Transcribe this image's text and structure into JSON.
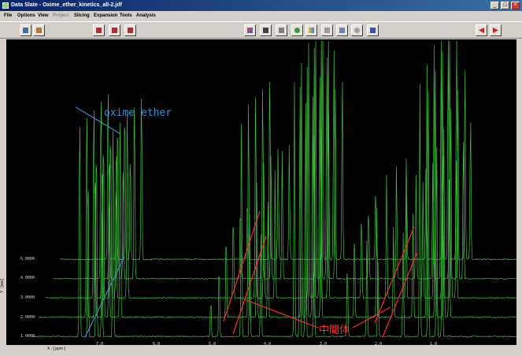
{
  "window": {
    "title": "Data Slate - Oxime_ether_kinetics_all-2.jdf",
    "controls": [
      "_",
      "□",
      "×"
    ]
  },
  "menu": [
    "File",
    "Options",
    "View",
    "Project",
    "Slicing",
    "Expansion",
    "Tools",
    "Analysis"
  ],
  "menu_disabled": [
    "Project"
  ],
  "toolbar_icons": [
    "save-icon",
    "print-icon",
    "stack-plot-icon",
    "overlay-icon",
    "slice-icon",
    "color-icon",
    "cube-icon",
    "layers-icon",
    "refresh-icon",
    "grid-icon",
    "3d-box-icon",
    "settings-icon",
    "zoom-icon",
    "music-note-icon",
    "arrow-left-icon",
    "arrow-right-icon"
  ],
  "colors": {
    "spectrum": "#3fbf3f",
    "blue_annotation": "#2f93d6",
    "red_annotation": "#ff2a2a",
    "background": "#000000"
  },
  "plot": {
    "y_axis_label": "Y : [sec]",
    "x_axis_label": "X : [ ppm ]",
    "y_ticks": [
      "5.0000",
      "4.0000",
      "3.0000",
      "2.0000",
      "1.0000"
    ],
    "x_ticks": [
      "7.0",
      "6.0",
      "5.0",
      "4.0",
      "3.0",
      "2.0",
      "1.0"
    ]
  },
  "annotations": {
    "oxime_ether": "oxime ether",
    "intermediate": "中間体"
  },
  "chart_data": {
    "type": "line",
    "title": "",
    "xlabel": "X : [ ppm ]",
    "ylabel": "Y : [sec]",
    "xlim": [
      8.2,
      -0.6
    ],
    "x_ticks": [
      7.0,
      6.0,
      5.0,
      4.0,
      3.0,
      2.0,
      1.0
    ],
    "y_ticks": [
      1.0,
      2.0,
      3.0,
      4.0,
      5.0
    ],
    "grid": false,
    "series": [
      {
        "y": 1.0,
        "peaks": [
          [
            7.35,
            0.95
          ],
          [
            7.2,
            0.7
          ],
          [
            7.05,
            0.85
          ],
          [
            6.95,
            0.6
          ],
          [
            6.75,
            0.9
          ],
          [
            5.0,
            0.15
          ],
          [
            4.85,
            0.3
          ],
          [
            4.45,
            0.9
          ],
          [
            4.3,
            0.5
          ],
          [
            4.1,
            0.4
          ],
          [
            3.5,
            1.0
          ],
          [
            3.4,
            1.0
          ],
          [
            3.3,
            0.95
          ],
          [
            3.15,
            0.85
          ],
          [
            2.55,
            0.3
          ],
          [
            2.2,
            0.4
          ],
          [
            2.0,
            0.3
          ],
          [
            1.55,
            0.4
          ],
          [
            1.25,
            1.0
          ],
          [
            1.1,
            1.0
          ],
          [
            0.95,
            0.8
          ],
          [
            0.85,
            0.6
          ]
        ]
      },
      {
        "y": 2.0,
        "peaks": [
          [
            7.35,
            0.9
          ],
          [
            7.2,
            0.65
          ],
          [
            7.05,
            0.8
          ],
          [
            6.95,
            0.55
          ],
          [
            6.75,
            0.85
          ],
          [
            4.85,
            0.35
          ],
          [
            4.45,
            0.9
          ],
          [
            4.3,
            0.55
          ],
          [
            4.1,
            0.45
          ],
          [
            3.5,
            1.0
          ],
          [
            3.4,
            1.0
          ],
          [
            3.3,
            0.9
          ],
          [
            3.15,
            0.8
          ],
          [
            2.55,
            0.35
          ],
          [
            2.15,
            0.45
          ],
          [
            1.85,
            0.35
          ],
          [
            1.5,
            0.4
          ],
          [
            1.25,
            1.0
          ],
          [
            1.1,
            1.0
          ],
          [
            0.95,
            0.8
          ],
          [
            0.85,
            0.6
          ]
        ]
      },
      {
        "y": 3.0,
        "peaks": [
          [
            7.35,
            0.85
          ],
          [
            7.2,
            0.6
          ],
          [
            7.05,
            0.75
          ],
          [
            6.95,
            0.5
          ],
          [
            6.75,
            0.8
          ],
          [
            4.85,
            0.35
          ],
          [
            4.45,
            0.85
          ],
          [
            4.3,
            0.55
          ],
          [
            4.1,
            0.5
          ],
          [
            3.5,
            1.0
          ],
          [
            3.4,
            1.0
          ],
          [
            3.3,
            0.9
          ],
          [
            3.15,
            0.8
          ],
          [
            2.55,
            0.35
          ],
          [
            2.1,
            0.5
          ],
          [
            1.75,
            0.4
          ],
          [
            1.45,
            0.45
          ],
          [
            1.25,
            1.0
          ],
          [
            1.1,
            1.0
          ],
          [
            0.95,
            0.8
          ],
          [
            0.85,
            0.6
          ]
        ]
      },
      {
        "y": 4.0,
        "peaks": [
          [
            7.35,
            0.8
          ],
          [
            7.2,
            0.55
          ],
          [
            7.05,
            0.7
          ],
          [
            6.95,
            0.5
          ],
          [
            6.75,
            0.75
          ],
          [
            4.85,
            0.3
          ],
          [
            4.45,
            0.8
          ],
          [
            4.3,
            0.5
          ],
          [
            4.1,
            0.5
          ],
          [
            3.5,
            1.0
          ],
          [
            3.4,
            1.0
          ],
          [
            3.3,
            0.9
          ],
          [
            3.15,
            0.8
          ],
          [
            2.55,
            0.3
          ],
          [
            2.05,
            0.45
          ],
          [
            1.7,
            0.4
          ],
          [
            1.4,
            0.45
          ],
          [
            1.25,
            1.0
          ],
          [
            1.1,
            1.0
          ],
          [
            0.95,
            0.8
          ],
          [
            0.85,
            0.6
          ]
        ]
      },
      {
        "y": 5.0,
        "peaks": [
          [
            7.35,
            0.75
          ],
          [
            7.2,
            0.5
          ],
          [
            7.05,
            0.65
          ],
          [
            6.95,
            0.45
          ],
          [
            6.75,
            0.7
          ],
          [
            4.85,
            0.25
          ],
          [
            4.45,
            0.75
          ],
          [
            4.3,
            0.45
          ],
          [
            4.1,
            0.45
          ],
          [
            3.5,
            1.0
          ],
          [
            3.4,
            1.0
          ],
          [
            3.3,
            0.85
          ],
          [
            3.15,
            0.75
          ],
          [
            2.55,
            0.3
          ],
          [
            2.0,
            0.4
          ],
          [
            1.65,
            0.35
          ],
          [
            1.35,
            0.4
          ],
          [
            1.25,
            1.0
          ],
          [
            1.1,
            1.0
          ],
          [
            0.95,
            0.8
          ],
          [
            0.85,
            0.6
          ]
        ]
      }
    ]
  }
}
